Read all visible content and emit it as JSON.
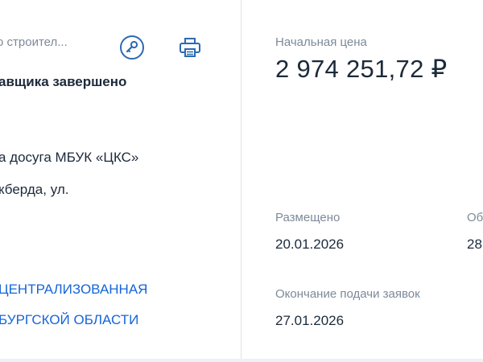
{
  "procurement": {
    "law_text": "о строител...",
    "stage": "авщика завершено",
    "object_lines": [
      "а досуга МБУК «ЦКС»",
      "кберда, ул."
    ],
    "customer_lines": [
      "ЦЕНТРАЛИЗОВАННАЯ",
      "БУРГСКОЙ ОБЛАСТИ"
    ],
    "icons": {
      "key": "key-icon",
      "print": "printer-icon"
    }
  },
  "price": {
    "label": "Начальная цена",
    "value": "2 974 251,72 ₽"
  },
  "dates": {
    "placed_label": "Размещено",
    "placed_value": "20.01.2026",
    "updated_label": "Об",
    "updated_value": "28",
    "end_label": "Окончание подачи заявок",
    "end_value": "27.01.2026"
  },
  "colors": {
    "link": "#1565d8",
    "icon": "#2c6ab0",
    "muted": "#7d8a99",
    "text": "#1b2a3a"
  }
}
